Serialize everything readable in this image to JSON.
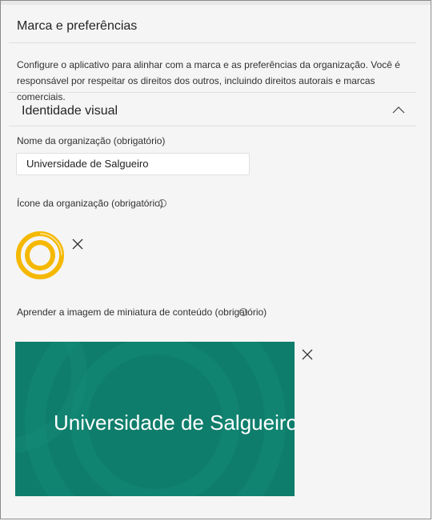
{
  "panel": {
    "title": "Marca e preferências",
    "description": "Configure o aplicativo para alinhar com a marca e as preferências da organização. Você é responsável por respeitar os direitos dos outros, incluindo direitos autorais e marcas comerciais."
  },
  "section": {
    "title": "Identidade visual",
    "expanded": true,
    "chevron_icon": "chevron-up-icon"
  },
  "org_name": {
    "label": "Nome da organização (obrigatório)",
    "value": "Universidade de Salgueiro"
  },
  "org_icon": {
    "label": "Ícone da organização (obrigatório)",
    "icon": "org-logo-rings",
    "color": "#f5b800",
    "remove_icon": "close-icon"
  },
  "thumbnail": {
    "label": "Aprender a imagem de miniatura de conteúdo (obrigatório)",
    "text": "Universidade de Salgueiro",
    "background_color": "#0f7d6b",
    "remove_icon": "close-icon"
  }
}
